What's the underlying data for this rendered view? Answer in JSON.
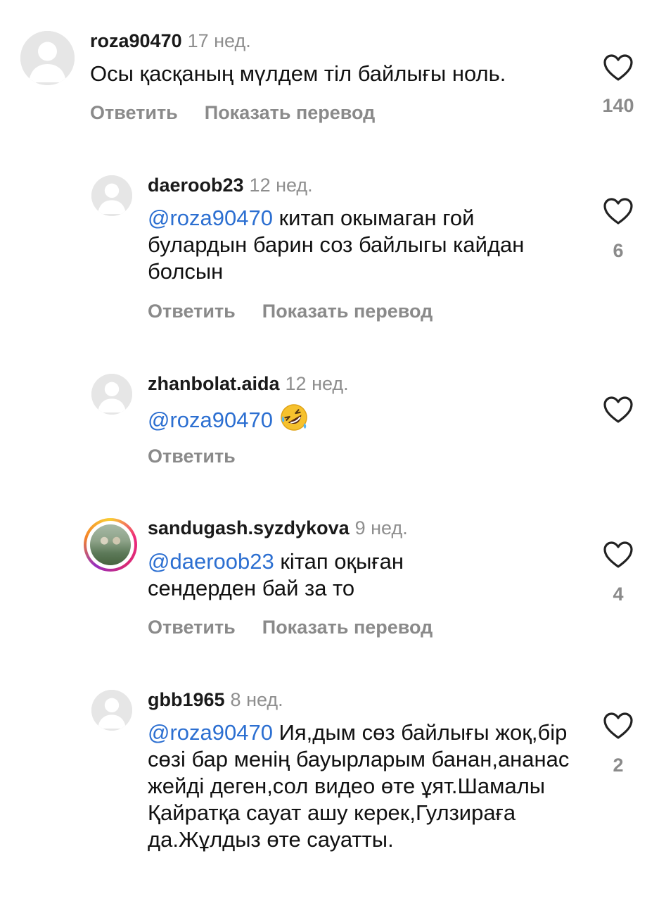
{
  "comments": [
    {
      "username": "roza90470",
      "time": "17 нед.",
      "mention": "",
      "text": "Осы қасқаның мүлдем тіл байлығы ноль.",
      "reply_label": "Ответить",
      "translate_label": "Показать перевод",
      "likes": "140"
    },
    {
      "username": "daeroob23",
      "time": "12 нед.",
      "mention": "@roza90470",
      "text": " китап окымаган гой булардын барин соз байлыгы кайдан болсын",
      "reply_label": "Ответить",
      "translate_label": "Показать перевод",
      "likes": "6"
    },
    {
      "username": "zhanbolat.aida",
      "time": "12 нед.",
      "mention": "@roza90470",
      "text": "",
      "emoji": "rolling-on-floor-laughing-emoji",
      "reply_label": "Ответить",
      "likes": ""
    },
    {
      "username": "sandugash.syzdykova",
      "time": "9 нед.",
      "mention": "@daeroob23",
      "text": " кітап оқыған сендерден бай за то",
      "reply_label": "Ответить",
      "translate_label": "Показать перевод",
      "likes": "4"
    },
    {
      "username": "gbb1965",
      "time": "8 нед.",
      "mention": "@roza90470",
      "text": " Ия,дым сөз байлығы жоқ,бір сөзі бар менің бауырларым банан,ананас жейді деген,сол видео өте ұят.Шамалы Қайратқа сауат ашу керек,Гулзираға да.Жұлдыз өте сауатты.",
      "likes": "2"
    }
  ],
  "colors": {
    "mention": "#2c6fd1",
    "muted": "#8e8e8e",
    "avatar_placeholder": "#e6e6e6"
  },
  "icons": {
    "like": "heart-outline-icon",
    "avatar": "default-avatar-icon"
  }
}
